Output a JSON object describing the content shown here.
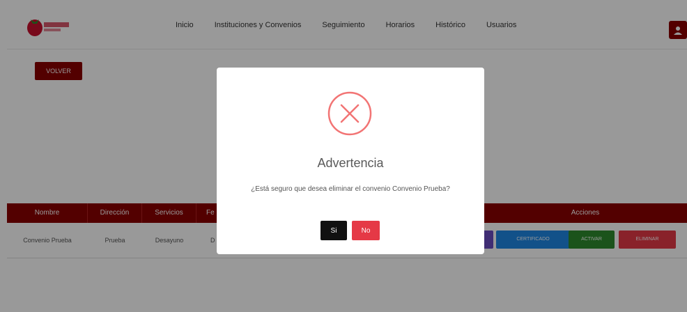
{
  "navbar": {
    "logo_label": "logo",
    "items": [
      {
        "label": "Inicio"
      },
      {
        "label": "Instituciones y Convenios"
      },
      {
        "label": "Seguimiento"
      },
      {
        "label": "Horarios"
      },
      {
        "label": "Histórico"
      },
      {
        "label": "Usuarios"
      }
    ]
  },
  "page": {
    "back_label": "VOLVER"
  },
  "table": {
    "headers": [
      "Nombre",
      "Dirección",
      "Servicios",
      "Fe",
      "Acciones"
    ],
    "row": {
      "nombre": "Convenio Prueba",
      "direccion": "Prueba",
      "servicios": "Desayuno",
      "fe": "D",
      "actions": [
        "CERTIFICADO",
        "ACTIVAR",
        "ELIMINAR"
      ]
    }
  },
  "modal": {
    "title": "Advertencia",
    "message": "¿Está seguro que desea eliminar el convenio Convenio Prueba?",
    "confirm_label": "Si",
    "cancel_label": "No"
  },
  "colors": {
    "brand": "#8b0000",
    "danger": "#e53946",
    "primary": "#1e88e5",
    "success": "#2e8b2e",
    "purple": "#6a4cc2"
  }
}
